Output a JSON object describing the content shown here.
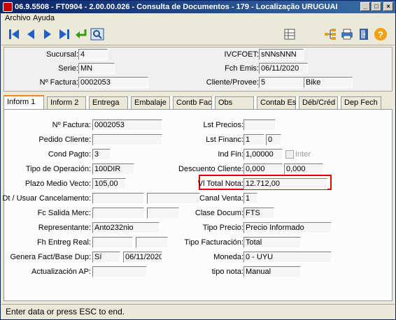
{
  "window": {
    "title": "06.9.5508 - FT0904 - 2.00.00.026 - Consulta de Documentos - 179 - Localização URUGUAI",
    "controls": [
      "_",
      "□",
      "×"
    ]
  },
  "menu": {
    "items": [
      "Archivo",
      "Ayuda"
    ]
  },
  "toolbar": {
    "left_icons": [
      "first-record-icon",
      "prev-record-icon",
      "next-record-icon",
      "last-record-icon",
      "enter-icon",
      "search-icon"
    ],
    "right_icons": [
      "grid-icon",
      "tree-icon",
      "print-icon",
      "exit-icon",
      "help-icon"
    ]
  },
  "header": {
    "sucursal_label": "Sucursal:",
    "sucursal_value": "4",
    "serie_label": "Serie:",
    "serie_value": "MN",
    "nfactura_label": "Nº Factura:",
    "nfactura_value": "0002053",
    "ivcfoet_label": "IVCFOET:",
    "ivcfoet_value": "sNNsNNN",
    "fchemis_label": "Fch Emis:",
    "fchemis_value": "06/11/2020",
    "cliente_label": "Cliente/Provee:",
    "cliente_value": "5",
    "cliente_name": "Bike"
  },
  "tabs": [
    {
      "label": "Inform 1",
      "active": true
    },
    {
      "label": "Inform 2",
      "active": false
    },
    {
      "label": "Entrega",
      "active": false
    },
    {
      "label": "Embalaje",
      "active": false
    },
    {
      "label": "Contb Fact",
      "active": false
    },
    {
      "label": "Obs",
      "active": false
    },
    {
      "label": "Contab Est",
      "active": false
    },
    {
      "label": "Déb/Créd",
      "active": false
    },
    {
      "label": "Dep Fech",
      "active": false
    }
  ],
  "form": {
    "left": {
      "nfactura_label": "Nº Factura:",
      "nfactura_value": "0002053",
      "pedido_label": "Pedido Cliente:",
      "pedido_value": "",
      "condpagto_label": "Cond Pagto:",
      "condpagto_value": "3",
      "tipooper_label": "Tipo de Operación:",
      "tipooper_value": "100DIR",
      "plazo_label": "Plazo Medio Vecto:",
      "plazo_value": "105,00",
      "dtusuar_label": "Dt / Usuar Cancelamento:",
      "fcsalida_label": "Fc Salida Merc:",
      "representante_label": "Representante:",
      "representante_value": "Anto232nio",
      "fhentreg_label": "Fh Entreg Real:",
      "generafact_label": "Genera Fact/Base Dup:",
      "generafact_value": "Sí",
      "generafact_date": "06/11/2020",
      "actualizacion_label": "Actualización AP:"
    },
    "right": {
      "lstprecios_label": "Lst Precios:",
      "lstprecios_value": "",
      "lstfinanc_label": "Lst Financ:",
      "lstfinanc_value1": "1",
      "lstfinanc_value2": "0",
      "indfin_label": "Ind Fin:",
      "indfin_value": "1,00000",
      "inter_label": "Inter",
      "descuento_label": "Descuento Cliente:",
      "descuento_value1": "0,000",
      "descuento_value2": "0,000",
      "vltotal_label": "Vl Total Nota:",
      "vltotal_value": "12.712,00",
      "canalventa_label": "Canal Venta:",
      "canalventa_value": "1",
      "clasedocum_label": "Clase Docum:",
      "clasedocum_value": "FTS",
      "tipoprecio_label": "Tipo Precio:",
      "tipoprecio_value": "Precio Informado",
      "tipofact_label": "Tipo Facturación:",
      "tipofact_value": "Total",
      "moneda_label": "Moneda:",
      "moneda_value": "0 - UYU",
      "tiponota_label": "tipo nota:",
      "tiponota_value": "Manual"
    }
  },
  "status": {
    "text": "Enter data or press ESC to end."
  },
  "colors": {
    "title_bar": "#0a246a",
    "highlight_box": "#e00000",
    "active_tab_accent": "#e68b2c"
  }
}
